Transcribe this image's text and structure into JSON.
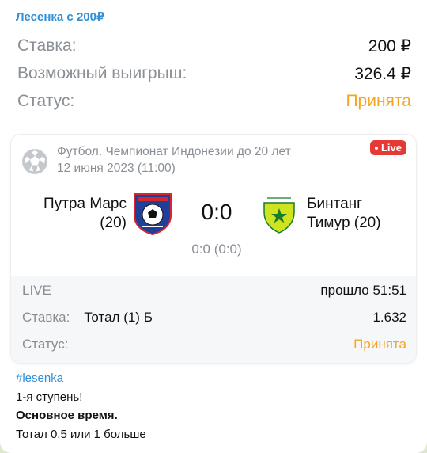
{
  "header": {
    "channel_name": "Лесенка с 200₽"
  },
  "summary": {
    "stake_label": "Ставка:",
    "stake_value": "200 ₽",
    "win_label": "Возможный выигрыш:",
    "win_value": "326.4 ₽",
    "status_label": "Статус:",
    "status_value": "Принята"
  },
  "match": {
    "league": "Футбол. Чемпионат Индонезии до 20 лет",
    "date": "12 июня 2023 (11:00)",
    "live_badge": "Live",
    "home_team_line1": "Путра Марс",
    "home_team_line2": "(20)",
    "away_team_line1": "Бинтанг",
    "away_team_line2": "Тимур (20)",
    "score": "0:0",
    "sub_score": "0:0 (0:0)",
    "period": "LIVE",
    "elapsed": "прошло 51:51",
    "bet_label": "Ставка:",
    "bet_name": "Тотал (1) Б",
    "odds": "1.632",
    "status_label": "Статус:",
    "status_value": "Принята"
  },
  "message": {
    "hashtag": "#lesenka",
    "line1": "1-я ступень!",
    "line2": "Основное время.",
    "line3": "Тотал 0.5 или 1 больше"
  },
  "colors": {
    "accent_blue": "#2f8fd8",
    "status_orange": "#f4a620",
    "live_red": "#e53935",
    "muted_grey": "#8a8f96"
  },
  "icons": {
    "sport": "football-icon",
    "home_logo": "putra-mars-logo",
    "away_logo": "bintang-timur-logo"
  }
}
